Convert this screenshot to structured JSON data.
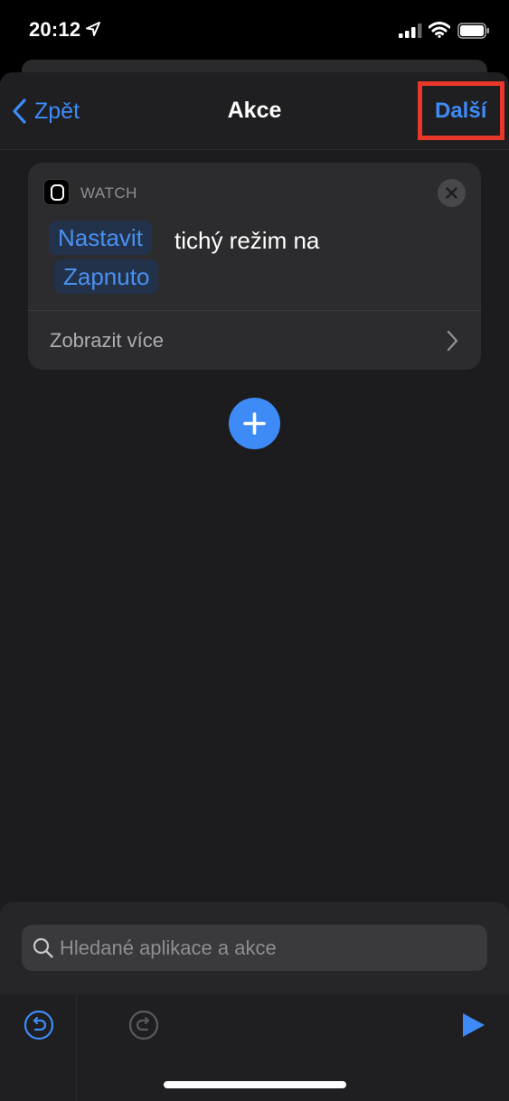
{
  "status_bar": {
    "time": "20:12",
    "icons": [
      "location-arrow-icon",
      "cellular-signal-icon",
      "wifi-icon",
      "battery-icon"
    ]
  },
  "nav": {
    "back_label": "Zpět",
    "title": "Akce",
    "next_label": "Další",
    "highlight_color": "#e8382a"
  },
  "action_card": {
    "app_label": "WATCH",
    "action_token": "Nastavit",
    "parameter_text": "tichý režim na",
    "value_token": "Zapnuto",
    "show_more_label": "Zobrazit více"
  },
  "search": {
    "placeholder": "Hledané aplikace a akce",
    "value": ""
  },
  "toolbar": {
    "icons": [
      "undo-icon",
      "redo-icon",
      "play-icon"
    ]
  },
  "colors": {
    "accent": "#3e8bf7",
    "background": "#1c1c1e",
    "card": "#2c2c2e"
  }
}
